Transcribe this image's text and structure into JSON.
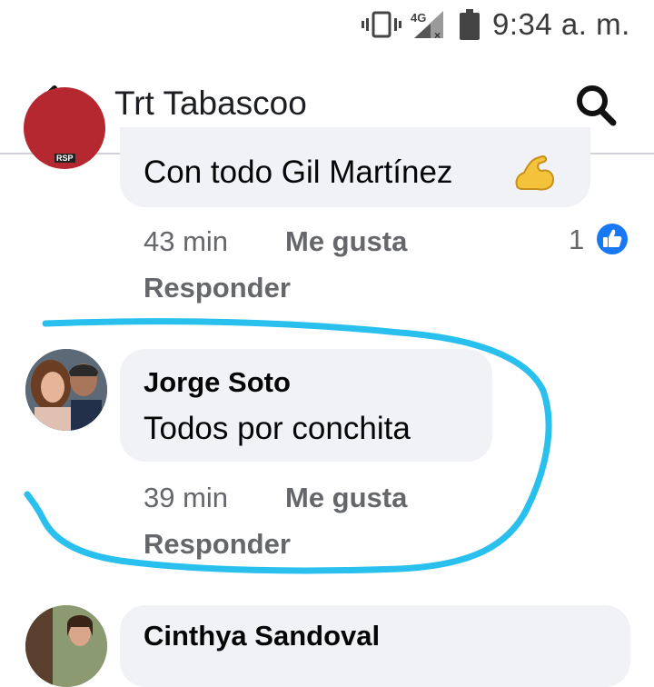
{
  "status_bar": {
    "network": "4G",
    "time": "9:34 a. m."
  },
  "header": {
    "title": "Trt Tabascoo"
  },
  "comments": [
    {
      "author": "",
      "avatar_badge": "RSP",
      "text": "Con todo Gil Martínez",
      "emoji": "flexed-biceps",
      "time": "43 min",
      "like_label": "Me gusta",
      "reply_label": "Responder",
      "reaction_count": "1",
      "reaction_type": "like"
    },
    {
      "author": "Jorge Soto",
      "text": "Todos por conchita",
      "time": "39 min",
      "like_label": "Me gusta",
      "reply_label": "Responder"
    },
    {
      "author": "Cinthya Sandoval"
    }
  ],
  "colors": {
    "accent_blue": "#1877f2",
    "annotation": "#29c0ee",
    "bubble": "#f0f2f5",
    "meta_text": "#65676b"
  }
}
